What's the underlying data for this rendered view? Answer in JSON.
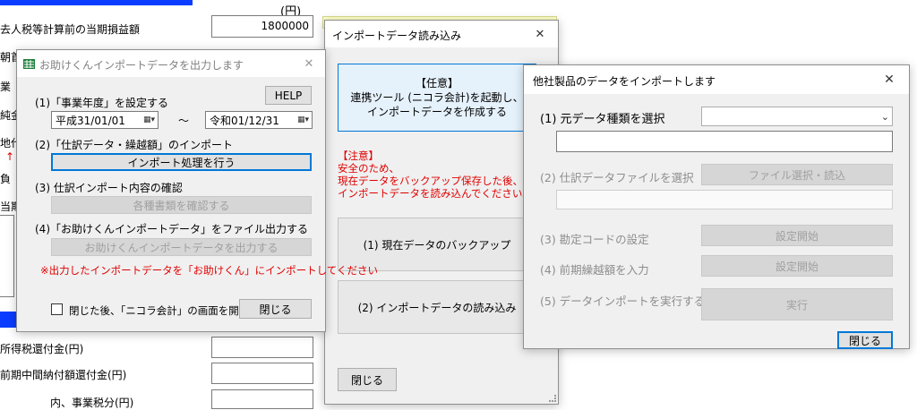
{
  "background": {
    "unit": "(円)",
    "amount_value": "1800000",
    "labels": {
      "pretax_income": "去人税等計算前の当期損益額",
      "row_a": "朝首",
      "row_b": "業",
      "row_c": "純金",
      "row_d": "地代",
      "row_e_arrow": "↑",
      "row_f": "負",
      "row_g": "当期",
      "income_tax_refund": "所得税還付金(円)",
      "interim_refund": "前期中間納付額還付金(円)",
      "business_tax": "内、事業税分(円)"
    },
    "colors": {
      "accent_blue": "#0a3dff",
      "note_yellow": "#ffffc8"
    }
  },
  "dialog1": {
    "title": "お助けくんインポートデータを出力します",
    "title_icon": "excel-grid-icon",
    "close_glyph": "✕",
    "help_label": "HELP",
    "step1_label": "(1)「事業年度」を設定する",
    "date_from": "平成31/01/01",
    "date_tilde": "～",
    "date_to": "令和01/12/31",
    "calendar_icon": "calendar-dropdown-icon",
    "step2_label": "(2)「仕訳データ・繰越額」のインポート",
    "import_button": "インポート処理を行う",
    "step3_label": "(3) 仕訳インポート内容の確認",
    "check_button": "各種書類を確認する",
    "step4_label": "(4)「お助けくんインポートデータ」をファイル出力する",
    "export_button": "お助けくんインポートデータを出力する",
    "warning": "※出力したインポートデータを「お助けくん」にインポートしてください",
    "checkbox_label": "閉じた後、「ニコラ会計」の画面を開く",
    "checkbox_checked": false,
    "close_button": "閉じる"
  },
  "dialog2": {
    "title": "インポートデータ読み込み",
    "close_glyph": "✕",
    "optional_line1": "【任意】",
    "optional_line2": "連携ツール (ニコラ会計)を起動し、",
    "optional_line3": "インポートデータを作成する",
    "note_line1": "【注意】",
    "note_line2": "安全のため、",
    "note_line3": "現在データをバックアップ保存した後、",
    "note_line4": "インポートデータを読み込んでください。",
    "backup_button": "(1) 現在データのバックアップ",
    "load_button": "(2) インポートデータの読み込み",
    "close_button": "閉じる"
  },
  "dialog3": {
    "title": "他社製品のデータをインポートします",
    "close_glyph": "✕",
    "step1_label": "(1) 元データ種類を選択",
    "step1_select_value": "",
    "step2_label": "(2) 仕訳データファイルを選択",
    "step2_button": "ファイル選択・読込",
    "step3_label": "(3) 勘定コードの設定",
    "step3_button": "設定開始",
    "step4_label": "(4) 前期繰越額を入力",
    "step4_button": "設定開始",
    "step5_label": "(5) データインポートを実行する",
    "step5_button": "実行",
    "close_button": "閉じる"
  }
}
